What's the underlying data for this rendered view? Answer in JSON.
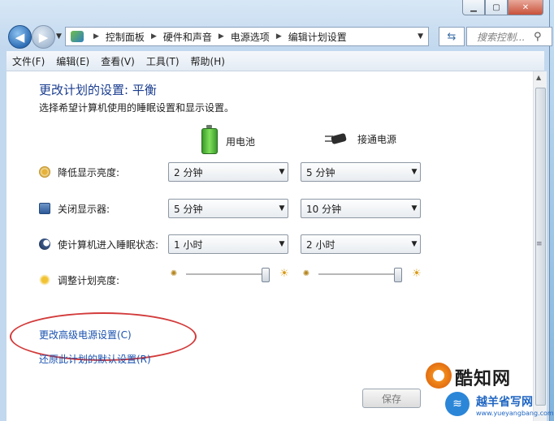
{
  "window": {
    "caption_buttons": [
      "minimize",
      "maximize",
      "close"
    ]
  },
  "nav": {
    "breadcrumbs": [
      "控制面板",
      "硬件和声音",
      "电源选项",
      "编辑计划设置"
    ],
    "search_placeholder": "搜索控制..."
  },
  "menu": [
    "文件(F)",
    "编辑(E)",
    "查看(V)",
    "工具(T)",
    "帮助(H)"
  ],
  "page": {
    "title": "更改计划的设置: 平衡",
    "subtitle": "选择希望计算机使用的睡眠设置和显示设置。"
  },
  "columns": {
    "battery": "用电池",
    "plugged": "接通电源"
  },
  "settings": {
    "dim": {
      "label": "降低显示亮度:",
      "battery": "2 分钟",
      "plugged": "5 分钟"
    },
    "off": {
      "label": "关闭显示器:",
      "battery": "5 分钟",
      "plugged": "10 分钟"
    },
    "sleep": {
      "label": "使计算机进入睡眠状态:",
      "battery": "1 小时",
      "plugged": "2 小时"
    },
    "brightness": {
      "label": "调整计划亮度:",
      "battery_level": 1.0,
      "plugged_level": 1.0
    }
  },
  "links": {
    "advanced": "更改高级电源设置(C)",
    "restore": "还原此计划的默认设置(R)"
  },
  "buttons": {
    "save": "保存"
  },
  "watermark": {
    "brand1": "酷知网",
    "brand2": "越羊省写网",
    "url": "www.yueyangbang.com"
  },
  "colors": {
    "title": "#1a3d8f",
    "link": "#1a52b0",
    "highlight_oval": "#d33b3b"
  }
}
